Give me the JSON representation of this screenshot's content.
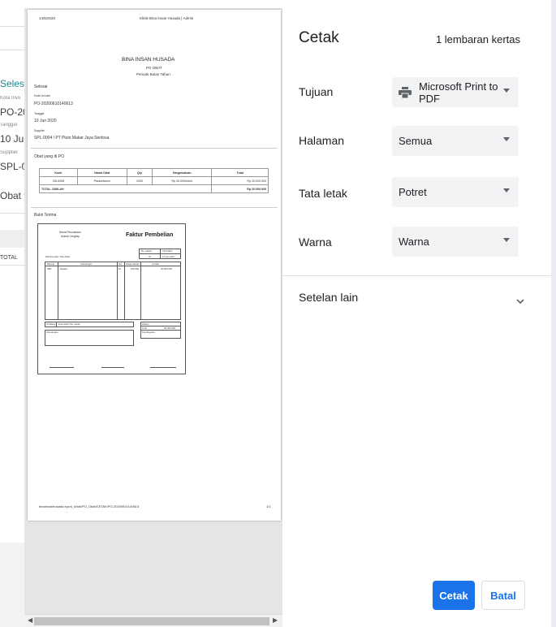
{
  "background": {
    "fragments": [
      "Seles",
      "Kota Invo",
      "PO-20",
      "Tanggal",
      "10 Jun",
      "Supplier",
      "SPL-0",
      "Obat y",
      "TOTAL"
    ]
  },
  "preview": {
    "header_date": "14/6/2020",
    "header_site": "Klinik Bina Insan Husada | Admin",
    "company": "BINA INSAN HUSADA",
    "doc_type": "PO OBAT",
    "period": "Periode Bulan Tahun",
    "status": "Selesai",
    "invoice_label": "Kode Invoice",
    "invoice_no": "PO-20200610140613",
    "date_label": "Tanggal",
    "date_value": "10 Jun 2020",
    "supplier_label": "Supplier",
    "supplier_value": "SPL-0004 / PT Pluto Makar Jaya Sentosa",
    "items_heading": "Obat yang di PO",
    "table": {
      "headers": [
        "Kode",
        "Nama Obat",
        "Qty",
        "Harga/satuan",
        "Total"
      ],
      "rows": [
        [
          "OB-0008",
          "Paracetamol",
          "1000",
          "Rp 20.000/botol",
          "Rp 20.000.000"
        ]
      ],
      "total_label": "TOTAL JUMLAH",
      "total_value": "Rp 20.000.000"
    },
    "receipt_heading": "Bukti Terima",
    "invoice_doc": {
      "company_line1": "Nama Perusahaan",
      "company_line2": "Alamat Lengkap",
      "title": "Faktur Pembelian",
      "no_label": "No. Faktur",
      "date_label": "Tgl Faktur",
      "no_value": "79",
      "date_value": "27 Jan 2017",
      "supplier_line": "Diterima dari: Toko Obat",
      "cols": [
        "Barang",
        "Keterangan",
        "Qty",
        "Harga satuan",
        "Jumlah"
      ],
      "row": [
        "OB1",
        "Masker",
        "10",
        "100.000",
        "20.000.000"
      ],
      "terbilang": "Terbilang",
      "terbilang_value": "Dua puluh ribu rupiah",
      "discount": "Diskon",
      "total": "Total",
      "total_value": "20.000.000",
      "notes": "Keterangan",
      "payment": "Pembayaran"
    },
    "footer_url": "binainsanhusada.xyz/a_klinik/PO_Obat/CETAK/PO-20200610140613",
    "page_num": "1/1"
  },
  "dialog": {
    "title": "Cetak",
    "sheets": "1 lembaran kertas",
    "destination_label": "Tujuan",
    "destination_value": "Microsoft Print to PDF",
    "pages_label": "Halaman",
    "pages_value": "Semua",
    "layout_label": "Tata letak",
    "layout_value": "Potret",
    "color_label": "Warna",
    "color_value": "Warna",
    "more_settings": "Setelan lain",
    "print_button": "Cetak",
    "cancel_button": "Batal",
    "accent_color": "#1a73e8",
    "icons": [
      "printer-icon",
      "chevron-down-icon"
    ]
  }
}
